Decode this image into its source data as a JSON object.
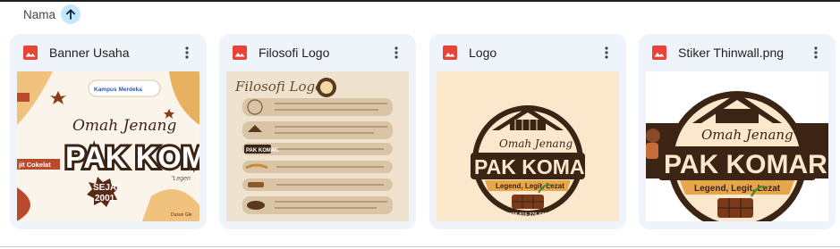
{
  "sort": {
    "label": "Nama",
    "direction_icon": "arrow-up-icon"
  },
  "files": [
    {
      "name": "Banner Usaha",
      "type_icon": "image-file-icon",
      "thumb": {
        "badge": "Kampus Merdeka",
        "script": "Omah Jenang",
        "brand": "PAK KOM",
        "brand_suffix": "\"Legen",
        "sejak": "SEJAK",
        "year": "2001",
        "side": "jit Cokelat",
        "corner": "Dusun Gle"
      }
    },
    {
      "name": "Filosofi Logo",
      "type_icon": "image-file-icon",
      "thumb": {
        "title": "Filosofi Logo",
        "mini_brand": "PAK KOMAR"
      }
    },
    {
      "name": "Logo",
      "type_icon": "image-file-icon",
      "thumb": {
        "script": "Omah Jenang",
        "brand": "PAK KOMAR",
        "tagline": "Legend, Legit, Lezat",
        "phone": "+628-816-276-689"
      }
    },
    {
      "name": "Stiker Thinwall.png",
      "type_icon": "image-file-icon",
      "thumb": {
        "script": "Omah Jenang",
        "brand": "PAK KOMAR",
        "tagline": "Legend, Legit, Lezat"
      }
    }
  ],
  "colors": {
    "accent": "#c2e7ff",
    "card_bg": "#eff3fa",
    "image_icon": "#ea4335",
    "brand_brown": "#3b2414",
    "cream": "#fbecd3"
  }
}
